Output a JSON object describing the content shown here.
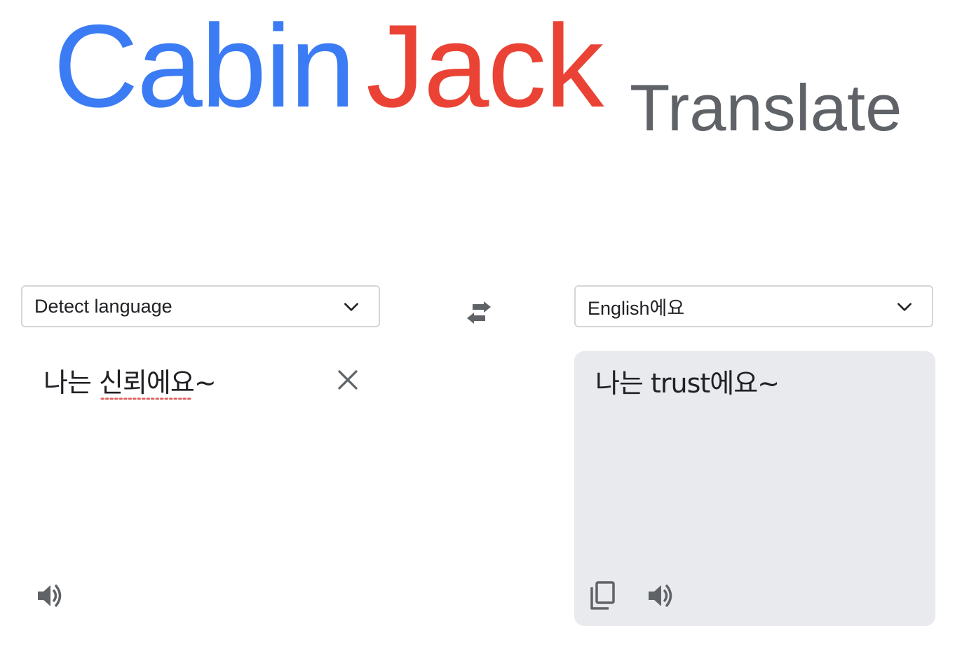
{
  "logo": {
    "part1": "Cabin",
    "part2": "Jack",
    "part3": "Translate"
  },
  "source": {
    "language_selected": "Detect language",
    "text": "나는 신뢰에요~",
    "clear_icon": "close-icon",
    "listen_icon": "speaker-icon"
  },
  "swap": {
    "icon": "swap-arrows-icon"
  },
  "target": {
    "language_selected": "English에요",
    "text": "나는 trust에요~",
    "copy_icon": "copy-icon",
    "listen_icon": "speaker-icon"
  },
  "colors": {
    "logo_blue": "#3b7cf4",
    "logo_red": "#ea4335",
    "logo_gray": "#5f6368",
    "output_panel_bg": "#e9eaee",
    "icon_gray": "#5f6368",
    "spellcheck_red": "#e06666"
  }
}
